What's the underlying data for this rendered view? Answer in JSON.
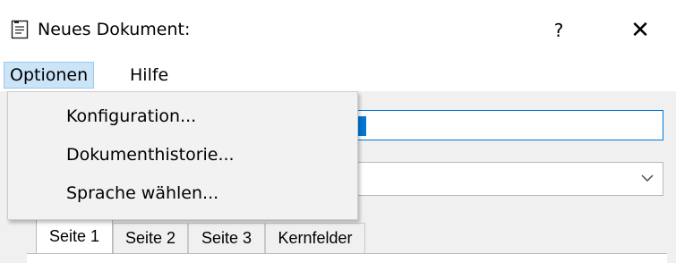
{
  "window": {
    "title": "Neues Dokument:",
    "icon": "document-icon",
    "help_label": "?",
    "close_label": "✕"
  },
  "menubar": {
    "items": [
      "Optionen",
      "Hilfe"
    ],
    "active": "Optionen"
  },
  "dropdown_menu": {
    "items": [
      "Konfiguration...",
      "Dokumenthistorie...",
      "Sprache wählen..."
    ]
  },
  "tabs": {
    "items": [
      "Seite 1",
      "Seite 2",
      "Seite 3",
      "Kernfelder"
    ],
    "selected": "Seite 1"
  },
  "colors": {
    "selection_blue": "#0078d7",
    "menu_highlight": "#cce4f7"
  }
}
